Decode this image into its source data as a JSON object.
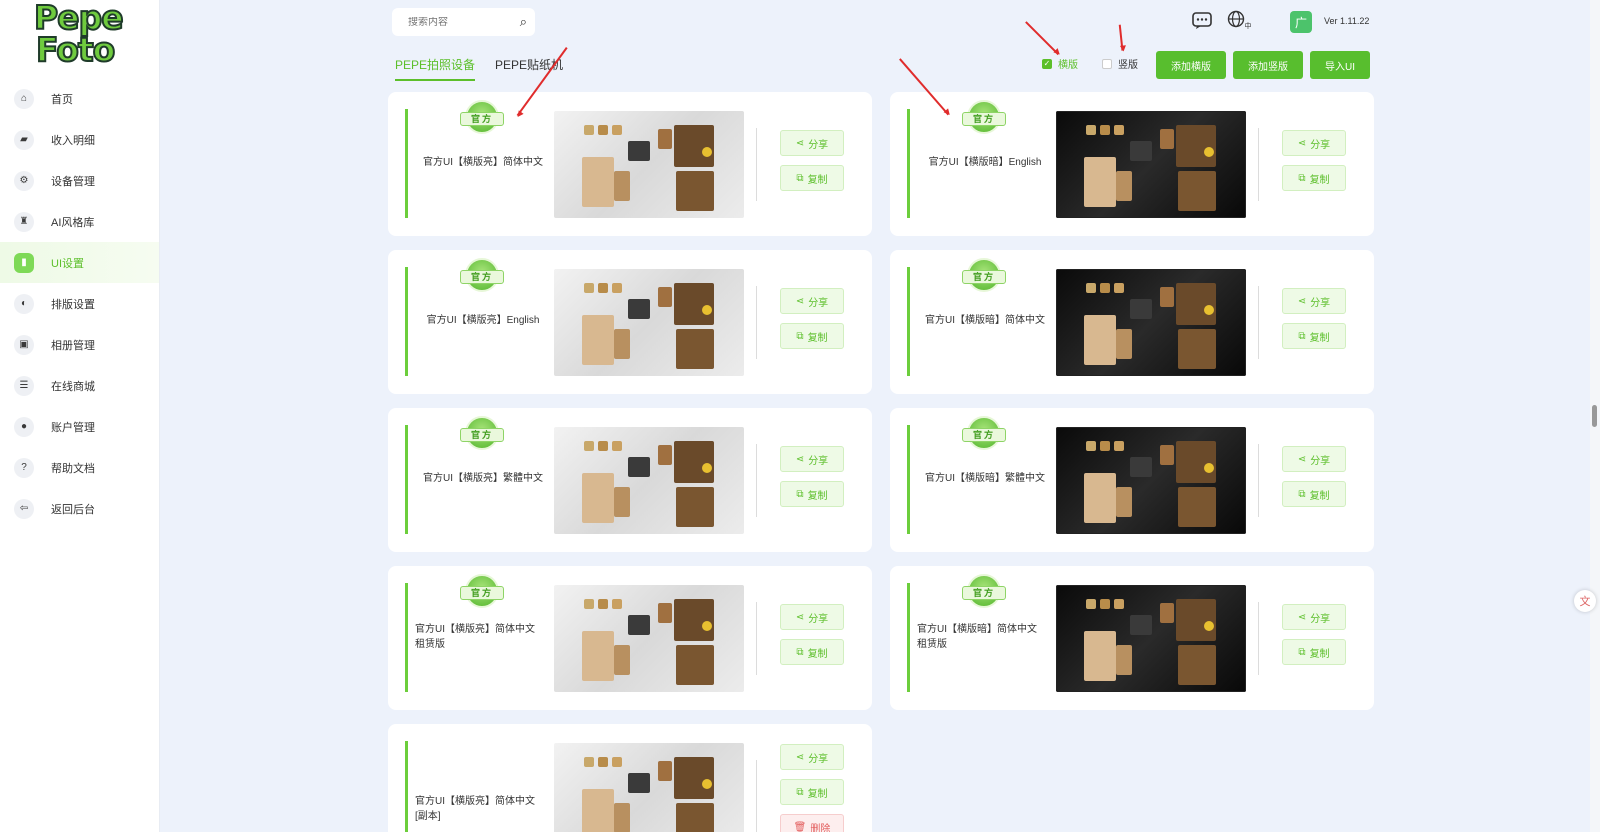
{
  "logo": {
    "line1": "Pepe",
    "line2": "Foto"
  },
  "sidebar": {
    "items": [
      {
        "label": "首页",
        "icon": "home-icon",
        "glyph": "⌂"
      },
      {
        "label": "收入明细",
        "icon": "wallet-icon",
        "glyph": "▰"
      },
      {
        "label": "设备管理",
        "icon": "gear-icon",
        "glyph": "⚙"
      },
      {
        "label": "AI风格库",
        "icon": "palette-icon",
        "glyph": "♜"
      },
      {
        "label": "UI设置",
        "icon": "ui-icon",
        "glyph": "▮",
        "active": true
      },
      {
        "label": "排版设置",
        "icon": "layout-icon",
        "glyph": "◐"
      },
      {
        "label": "相册管理",
        "icon": "album-icon",
        "glyph": "▣"
      },
      {
        "label": "在线商城",
        "icon": "shop-icon",
        "glyph": "☰"
      },
      {
        "label": "账户管理",
        "icon": "user-icon",
        "glyph": "●"
      },
      {
        "label": "帮助文档",
        "icon": "help-icon",
        "glyph": "?"
      },
      {
        "label": "返回后台",
        "icon": "back-icon",
        "glyph": "⇦"
      }
    ]
  },
  "search": {
    "placeholder": "搜索内容"
  },
  "topbar": {
    "lang_glyph": "中",
    "ad_glyph": "广",
    "version": "Ver 1.11.22"
  },
  "tabs": [
    {
      "label": "PEPE拍照设备",
      "active": true
    },
    {
      "label": "PEPE贴纸机"
    }
  ],
  "filters": {
    "landscape": "横版",
    "portrait": "竖版"
  },
  "toolbar": {
    "add_landscape": "添加横版",
    "add_portrait": "添加竖版",
    "import_ui": "导入UI"
  },
  "badge_text": "官方",
  "actions": {
    "share": "分享",
    "copy": "复制",
    "delete": "删除"
  },
  "cards": [
    {
      "name": "官方UI【横版亮】简体中文",
      "theme": "light",
      "official": true
    },
    {
      "name": "官方UI【横版暗】English",
      "theme": "dark",
      "official": true
    },
    {
      "name": "官方UI【横版亮】English",
      "theme": "light",
      "official": true
    },
    {
      "name": "官方UI【横版暗】简体中文",
      "theme": "dark",
      "official": true
    },
    {
      "name": "官方UI【横版亮】繁體中文",
      "theme": "light",
      "official": true
    },
    {
      "name": "官方UI【横版暗】繁體中文",
      "theme": "dark",
      "official": true
    },
    {
      "name": "官方UI【横版亮】简体中文",
      "name2": "租赁版",
      "theme": "light",
      "official": true
    },
    {
      "name": "官方UI【横版暗】简体中文",
      "name2": "租赁版",
      "theme": "dark",
      "official": true
    },
    {
      "name": "官方UI【横版亮】简体中文",
      "name2": "[副本]",
      "theme": "light",
      "official": false,
      "deletable": true
    }
  ],
  "colors": {
    "accent": "#58be2e",
    "danger": "#e25b5b",
    "annotation": "#e02c2c"
  }
}
